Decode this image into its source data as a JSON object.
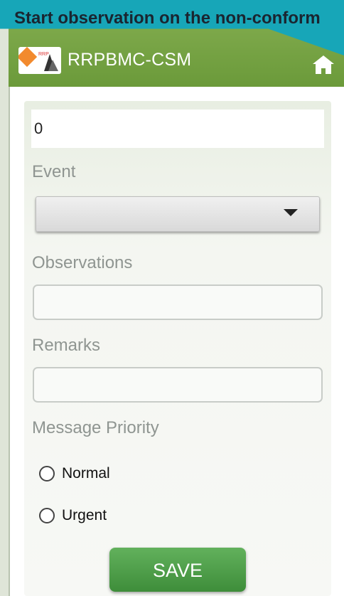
{
  "banner": {
    "text": "Start observation on the non-conform"
  },
  "appbar": {
    "title": "RRPBMC-CSM",
    "logo_icon": "organization-logo",
    "home_icon": "home-icon"
  },
  "form": {
    "id_value": "0",
    "event_label": "Event",
    "event_selected": "",
    "observations_label": "Observations",
    "observations_value": "",
    "remarks_label": "Remarks",
    "remarks_value": "",
    "priority_label": "Message Priority",
    "priority_options": [
      "Normal",
      "Urgent"
    ],
    "save_label": "SAVE"
  },
  "colors": {
    "appbar": "#6b9a3a",
    "banner": "#17a6b8",
    "save_button": "#4a9a45"
  }
}
